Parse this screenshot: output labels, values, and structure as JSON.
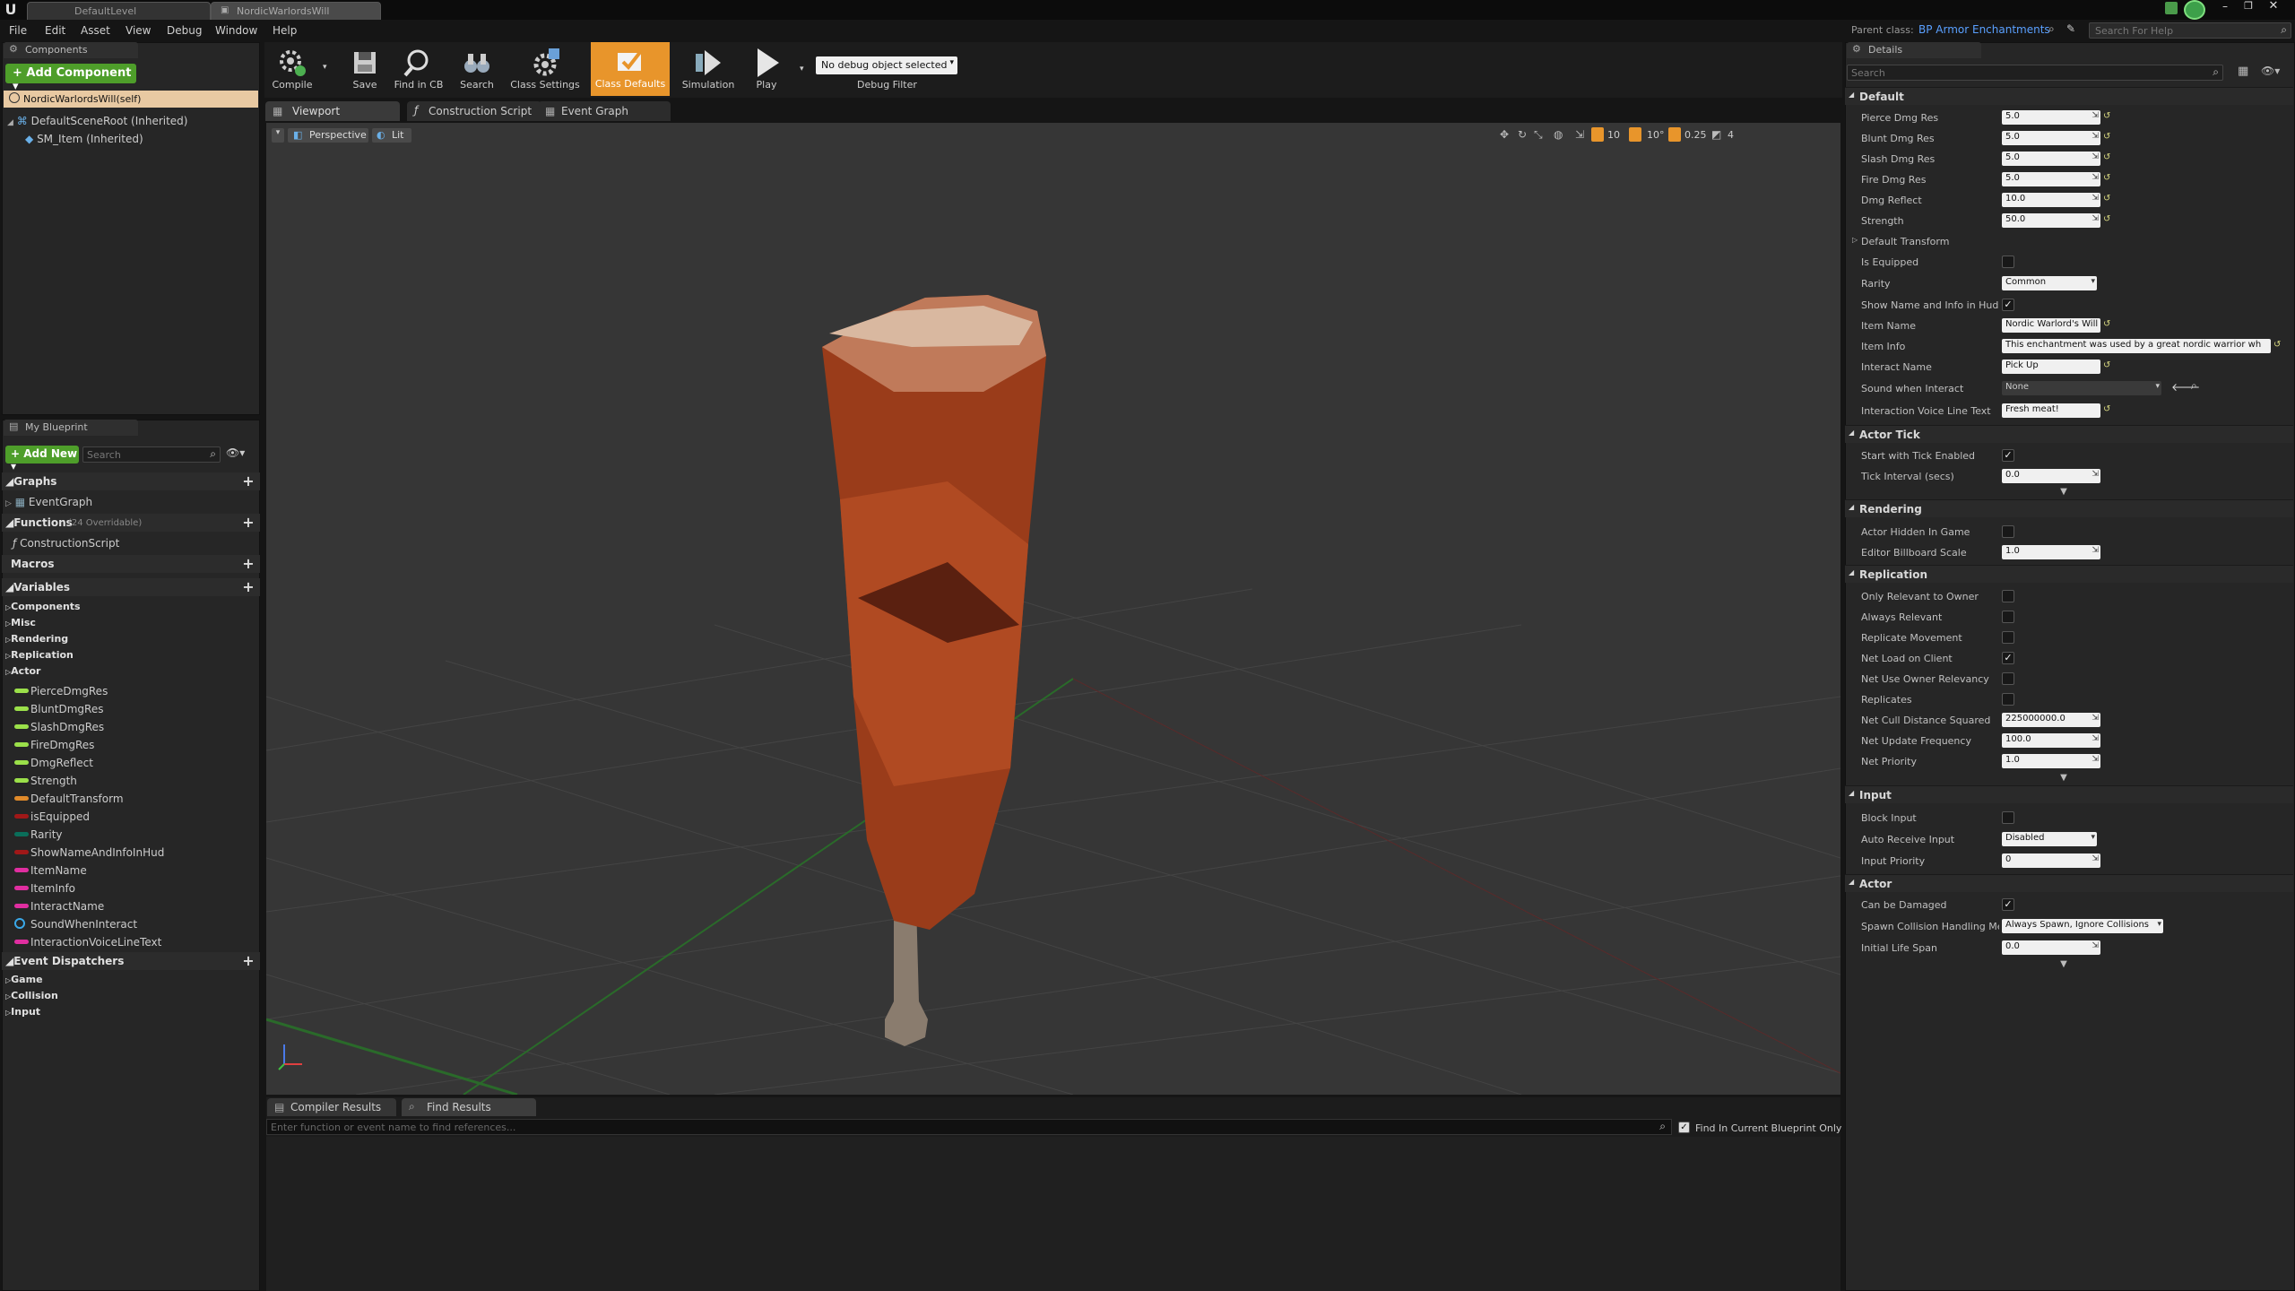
{
  "window": {
    "tabs": [
      "DefaultLevel",
      "NordicWarlordsWill"
    ],
    "parent_class_label": "Parent class:",
    "parent_class_value": "BP Armor Enchantments",
    "help_placeholder": "Search For Help"
  },
  "menu": [
    "File",
    "Edit",
    "Asset",
    "View",
    "Debug",
    "Window",
    "Help"
  ],
  "components": {
    "title": "Components",
    "add_button": "+ Add Component ▾",
    "self_item": "NordicWarlordsWill(self)",
    "items": [
      "DefaultSceneRoot (Inherited)",
      "SM_Item (Inherited)"
    ]
  },
  "toolbar": {
    "compile": "Compile",
    "save": "Save",
    "find_in_cb": "Find in CB",
    "search": "Search",
    "class_settings": "Class Settings",
    "class_defaults": "Class Defaults",
    "simulation": "Simulation",
    "play": "Play",
    "debug_object": "No debug object selected",
    "debug_filter": "Debug Filter"
  },
  "editor_tabs": [
    "Viewport",
    "Construction Script",
    "Event Graph"
  ],
  "viewport": {
    "perspective": "Perspective",
    "lit": "Lit",
    "grid_snap": "10",
    "rot_snap": "10°",
    "scale_snap": "0.25",
    "camera_speed": "4"
  },
  "my_blueprint": {
    "title": "My Blueprint",
    "add_new": "+ Add New ▾",
    "search_placeholder": "Search",
    "graphs_label": "Graphs",
    "graph_item": "EventGraph",
    "functions_label": "Functions",
    "functions_count": "(24 Overridable)",
    "function_item": "ConstructionScript",
    "macros_label": "Macros",
    "variables_label": "Variables",
    "variable_categories": [
      "Components",
      "Misc",
      "Rendering",
      "Replication",
      "Actor"
    ],
    "variables": [
      {
        "name": "PierceDmgRes",
        "color": "#9be04a"
      },
      {
        "name": "BluntDmgRes",
        "color": "#9be04a"
      },
      {
        "name": "SlashDmgRes",
        "color": "#9be04a"
      },
      {
        "name": "FireDmgRes",
        "color": "#9be04a"
      },
      {
        "name": "DmgReflect",
        "color": "#9be04a"
      },
      {
        "name": "Strength",
        "color": "#9be04a"
      },
      {
        "name": "DefaultTransform",
        "color": "#e08a2a"
      },
      {
        "name": "isEquipped",
        "color": "#a01818"
      },
      {
        "name": "Rarity",
        "color": "#0a6e5a"
      },
      {
        "name": "ShowNameAndInfoInHud",
        "color": "#a01818"
      },
      {
        "name": "ItemName",
        "color": "#e02ea0"
      },
      {
        "name": "ItemInfo",
        "color": "#e02ea0"
      },
      {
        "name": "InteractName",
        "color": "#e02ea0"
      },
      {
        "name": "SoundWhenInteract",
        "color": "#3aa8e8"
      },
      {
        "name": "InteractionVoiceLineText",
        "color": "#e02ea0"
      }
    ],
    "event_dispatchers_label": "Event Dispatchers",
    "dispatcher_categories": [
      "Game",
      "Collision",
      "Input"
    ]
  },
  "bottom": {
    "tabs": [
      "Compiler Results",
      "Find Results"
    ],
    "find_placeholder": "Enter function or event name to find references...",
    "find_current_label": "Find In Current Blueprint Only"
  },
  "details": {
    "title": "Details",
    "search_placeholder": "Search",
    "default_section": "Default",
    "default_rows": [
      {
        "label": "Pierce Dmg Res",
        "value": "5.0"
      },
      {
        "label": "Blunt Dmg Res",
        "value": "5.0"
      },
      {
        "label": "Slash Dmg Res",
        "value": "5.0"
      },
      {
        "label": "Fire Dmg Res",
        "value": "5.0"
      },
      {
        "label": "Dmg Reflect",
        "value": "10.0"
      },
      {
        "label": "Strength",
        "value": "50.0"
      }
    ],
    "default_transform": "Default Transform",
    "is_equipped": "Is Equipped",
    "rarity_label": "Rarity",
    "rarity_value": "Common",
    "show_name_label": "Show Name and Info in Hud",
    "item_name_label": "Item Name",
    "item_name_value": "Nordic Warlord's Will",
    "item_info_label": "Item Info",
    "item_info_value": "This enchantment was used by a great nordic warrior wh",
    "interact_name_label": "Interact Name",
    "interact_name_value": "Pick Up",
    "sound_label": "Sound when Interact",
    "sound_value": "None",
    "voice_label": "Interaction Voice Line Text",
    "voice_value": "Fresh meat!",
    "actor_tick_section": "Actor Tick",
    "tick_enabled_label": "Start with Tick Enabled",
    "tick_interval_label": "Tick Interval (secs)",
    "tick_interval_value": "0.0",
    "rendering_section": "Rendering",
    "hidden_label": "Actor Hidden In Game",
    "billboard_label": "Editor Billboard Scale",
    "billboard_value": "1.0",
    "replication_section": "Replication",
    "rep_checks": [
      {
        "label": "Only Relevant to Owner",
        "checked": false
      },
      {
        "label": "Always Relevant",
        "checked": false
      },
      {
        "label": "Replicate Movement",
        "checked": false
      },
      {
        "label": "Net Load on Client",
        "checked": true
      },
      {
        "label": "Net Use Owner Relevancy",
        "checked": false
      },
      {
        "label": "Replicates",
        "checked": false
      }
    ],
    "rep_values": [
      {
        "label": "Net Cull Distance Squared",
        "value": "225000000.0"
      },
      {
        "label": "Net Update Frequency",
        "value": "100.0"
      },
      {
        "label": "Net Priority",
        "value": "1.0"
      }
    ],
    "input_section": "Input",
    "block_input_label": "Block Input",
    "auto_receive_label": "Auto Receive Input",
    "auto_receive_value": "Disabled",
    "input_priority_label": "Input Priority",
    "input_priority_value": "0",
    "actor_section": "Actor",
    "can_damaged_label": "Can be Damaged",
    "spawn_label": "Spawn Collision Handling Met",
    "spawn_value": "Always Spawn, Ignore Collisions",
    "life_span_label": "Initial Life Span",
    "life_span_value": "0.0"
  },
  "colors": {
    "accent": "#e8952b",
    "add_green": "#5aa82a"
  }
}
